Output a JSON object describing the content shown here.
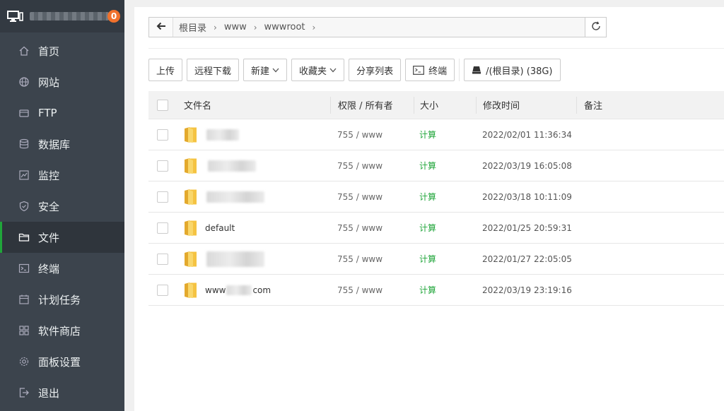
{
  "sidebar": {
    "badge": "0",
    "items": [
      {
        "label": "首页",
        "icon": "home-icon",
        "active": false
      },
      {
        "label": "网站",
        "icon": "globe-icon",
        "active": false
      },
      {
        "label": "FTP",
        "icon": "ftp-icon",
        "active": false
      },
      {
        "label": "数据库",
        "icon": "database-icon",
        "active": false
      },
      {
        "label": "监控",
        "icon": "monitor-chart-icon",
        "active": false
      },
      {
        "label": "安全",
        "icon": "shield-icon",
        "active": false
      },
      {
        "label": "文件",
        "icon": "folder-icon",
        "active": true
      },
      {
        "label": "终端",
        "icon": "terminal-icon",
        "active": false
      },
      {
        "label": "计划任务",
        "icon": "calendar-icon",
        "active": false
      },
      {
        "label": "软件商店",
        "icon": "grid-icon",
        "active": false
      },
      {
        "label": "面板设置",
        "icon": "gear-icon",
        "active": false
      },
      {
        "label": "退出",
        "icon": "logout-icon",
        "active": false
      }
    ]
  },
  "path": {
    "crumbs": [
      "根目录",
      "www",
      "wwwroot"
    ]
  },
  "toolbar": {
    "upload": "上传",
    "remote_download": "远程下载",
    "new": "新建",
    "favorites": "收藏夹",
    "share_list": "分享列表",
    "terminal": "终端",
    "disk": "/(根目录) (38G)"
  },
  "table": {
    "headers": {
      "name": "文件名",
      "perm": "权限 / 所有者",
      "size": "大小",
      "time": "修改时间",
      "note": "备注"
    },
    "rows": [
      {
        "name": "",
        "perm": "755 / www",
        "size": "计算",
        "time": "2022/02/01 11:36:34"
      },
      {
        "name": "",
        "perm": "755 / www",
        "size": "计算",
        "time": "2022/03/19 16:05:08"
      },
      {
        "name": "",
        "perm": "755 / www",
        "size": "计算",
        "time": "2022/03/18 10:11:09"
      },
      {
        "name": "default",
        "perm": "755 / www",
        "size": "计算",
        "time": "2022/01/25 20:59:31"
      },
      {
        "name": "",
        "perm": "755 / www",
        "size": "计算",
        "time": "2022/01/27 22:05:05"
      },
      {
        "name_prefix": "www",
        "name_suffix": "com",
        "perm": "755 / www",
        "size": "计算",
        "time": "2022/03/19 23:19:16"
      }
    ]
  },
  "colors": {
    "sidebar_bg": "#3c444d",
    "accent_green": "#20a53a",
    "badge_orange": "#f0712c",
    "folder_yellow": "#f5c342"
  }
}
